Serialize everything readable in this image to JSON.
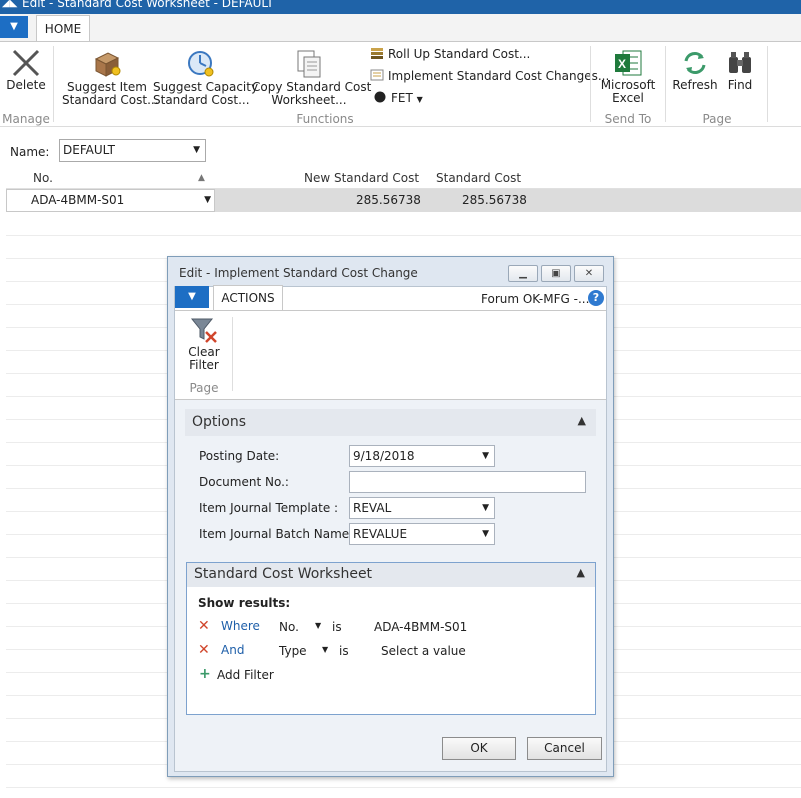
{
  "window": {
    "title": "Edit - Standard Cost Worksheet - DEFAULT"
  },
  "ribbon": {
    "tabs": [
      "HOME"
    ],
    "buttons": {
      "delete": "Delete",
      "suggest_item_l1": "Suggest Item",
      "suggest_item_l2": "Standard Cost...",
      "suggest_capacity_l1": "Suggest Capacity",
      "suggest_capacity_l2": "Standard Cost...",
      "copy_cost_l1": "Copy Standard Cost",
      "copy_cost_l2": "Worksheet...",
      "roll_up": "Roll Up Standard Cost...",
      "implement": "Implement Standard Cost Changes...",
      "fet": "FET",
      "excel_l1": "Microsoft",
      "excel_l2": "Excel",
      "refresh": "Refresh",
      "find": "Find"
    },
    "groups": {
      "manage": "Manage",
      "functions": "Functions",
      "send_to": "Send To",
      "page": "Page"
    }
  },
  "name_bar": {
    "label": "Name:",
    "value": "DEFAULT"
  },
  "grid": {
    "columns": {
      "no": "No.",
      "new_cost": "New Standard Cost",
      "cost": "Standard Cost"
    },
    "rows": [
      {
        "no": "ADA-4BMM-S01",
        "new_cost": "285.56738",
        "cost": "285.56738"
      }
    ]
  },
  "dialog": {
    "title": "Edit - Implement Standard Cost Change",
    "tab": "ACTIONS",
    "company": "Forum OK-MFG -...",
    "clear_filter_l1": "Clear",
    "clear_filter_l2": "Filter",
    "ribbon_group": "Page",
    "options": {
      "header": "Options",
      "posting_date_label": "Posting Date:",
      "posting_date": "9/18/2018",
      "document_no_label": "Document No.:",
      "document_no": "",
      "template_label": "Item Journal Template :",
      "template": "REVAL",
      "batch_label": "Item Journal Batch Name:",
      "batch": "REVALUE"
    },
    "worksheet": {
      "header": "Standard Cost Worksheet",
      "show_results": "Show results:",
      "filters": [
        {
          "conj": "Where",
          "field": "No.",
          "op": "is",
          "value": "ADA-4BMM-S01"
        },
        {
          "conj": "And",
          "field": "Type",
          "op": "is",
          "value": "Select a value"
        }
      ],
      "add_filter": "Add Filter"
    },
    "ok": "OK",
    "cancel": "Cancel"
  },
  "colors": {
    "accent": "#1d6ec4",
    "title_bar": "#1f63a8",
    "link": "#1f5fa9",
    "remove": "#d0452b"
  }
}
